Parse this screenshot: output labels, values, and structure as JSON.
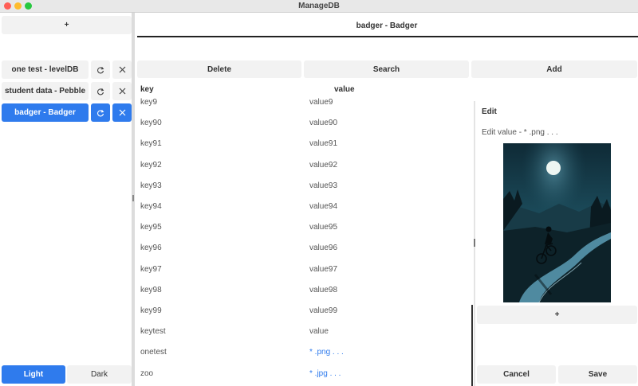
{
  "window": {
    "title": "ManageDB",
    "traffic_lights": {
      "close": "#ff5f57",
      "minimize": "#febc2e",
      "zoom": "#28c840"
    }
  },
  "sidebar": {
    "add_label": "+",
    "connections": [
      {
        "label": "one test - levelDB",
        "active": false
      },
      {
        "label": "student data - Pebble",
        "active": false
      },
      {
        "label": "badger - Badger",
        "active": true
      }
    ],
    "refresh_icon": "refresh-icon",
    "close_icon": "close-icon",
    "theme": {
      "light_label": "Light",
      "dark_label": "Dark",
      "selected": "Light"
    }
  },
  "main": {
    "tab_title": "badger - Badger",
    "toolbar": {
      "delete_label": "Delete",
      "search_label": "Search",
      "add_label": "Add"
    },
    "table": {
      "columns": [
        "key",
        "value"
      ],
      "rows": [
        {
          "key": "key9",
          "value": "value9"
        },
        {
          "key": "key90",
          "value": "value90"
        },
        {
          "key": "key91",
          "value": "value91"
        },
        {
          "key": "key92",
          "value": "value92"
        },
        {
          "key": "key93",
          "value": "value93"
        },
        {
          "key": "key94",
          "value": "value94"
        },
        {
          "key": "key95",
          "value": "value95"
        },
        {
          "key": "key96",
          "value": "value96"
        },
        {
          "key": "key97",
          "value": "value97"
        },
        {
          "key": "key98",
          "value": "value98"
        },
        {
          "key": "key99",
          "value": "value99"
        },
        {
          "key": "keytest",
          "value": "value"
        },
        {
          "key": "onetest",
          "value": "* .png . . ."
        },
        {
          "key": "zoo",
          "value": "* .jpg . . ."
        }
      ]
    }
  },
  "edit_panel": {
    "title": "Edit",
    "subtitle": "Edit value - * .png . . .",
    "add_label": "+",
    "cancel_label": "Cancel",
    "save_label": "Save"
  },
  "colors": {
    "accent": "#2f7bed",
    "button_bg": "#f2f2f2"
  }
}
